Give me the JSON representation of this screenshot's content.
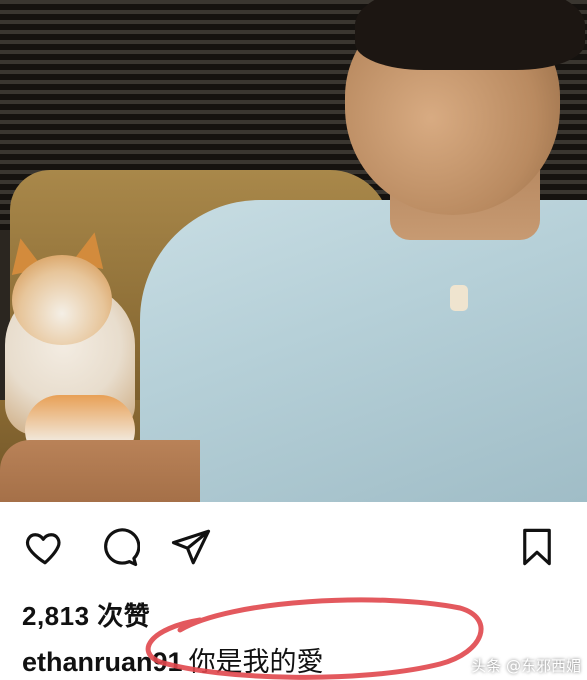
{
  "post": {
    "photo_alt": "",
    "likes_text": "2,813 次赞",
    "caption": {
      "username": "ethanruan91",
      "text": "你是我的愛"
    }
  },
  "actions": {
    "like_icon": "heart-icon",
    "comment_icon": "comment-icon",
    "share_icon": "send-icon",
    "save_icon": "bookmark-icon"
  },
  "watermark": {
    "text": "头条 @东邪西媚"
  },
  "colors": {
    "highlight_stroke": "#e0474c",
    "text": "#111111",
    "icon": "#111111"
  }
}
